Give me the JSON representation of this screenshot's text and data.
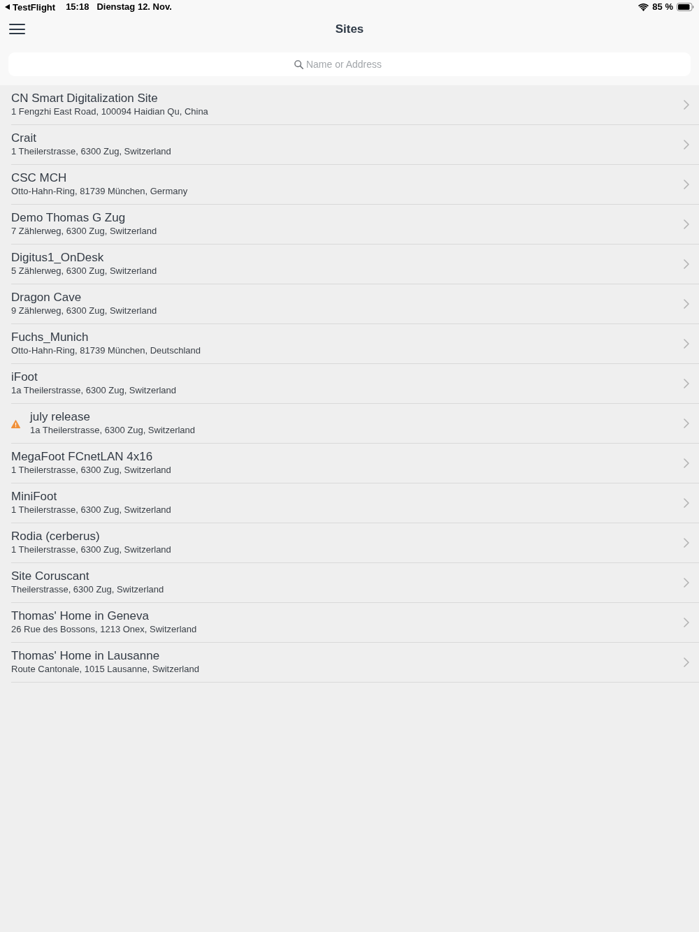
{
  "status_bar": {
    "back_app": "TestFlight",
    "time": "15:18",
    "date": "Dienstag 12. Nov.",
    "battery": "85 %"
  },
  "nav_bar": {
    "title": "Sites"
  },
  "search": {
    "placeholder": "Name or Address"
  },
  "sites": [
    {
      "name": "CN Smart Digitalization Site",
      "address": "1 Fengzhi East Road, 100094 Haidian Qu, China",
      "warning": false
    },
    {
      "name": "Crait",
      "address": "1 Theilerstrasse, 6300 Zug, Switzerland",
      "warning": false
    },
    {
      "name": "CSC MCH",
      "address": "Otto-Hahn-Ring, 81739 München, Germany",
      "warning": false
    },
    {
      "name": "Demo Thomas G Zug",
      "address": "7 Zählerweg, 6300 Zug, Switzerland",
      "warning": false
    },
    {
      "name": "Digitus1_OnDesk",
      "address": "5 Zählerweg, 6300 Zug, Switzerland",
      "warning": false
    },
    {
      "name": "Dragon Cave",
      "address": "9 Zählerweg, 6300 Zug, Switzerland",
      "warning": false
    },
    {
      "name": "Fuchs_Munich",
      "address": "Otto-Hahn-Ring, 81739 München, Deutschland",
      "warning": false
    },
    {
      "name": "iFoot",
      "address": "1a Theilerstrasse, 6300 Zug, Switzerland",
      "warning": false
    },
    {
      "name": "july release",
      "address": "1a Theilerstrasse, 6300 Zug, Switzerland",
      "warning": true
    },
    {
      "name": "MegaFoot FCnetLAN 4x16",
      "address": "1 Theilerstrasse, 6300 Zug, Switzerland",
      "warning": false
    },
    {
      "name": "MiniFoot",
      "address": "1 Theilerstrasse, 6300 Zug, Switzerland",
      "warning": false
    },
    {
      "name": "Rodia (cerberus)",
      "address": "1 Theilerstrasse, 6300 Zug, Switzerland",
      "warning": false
    },
    {
      "name": "Site Coruscant",
      "address": "Theilerstrasse, 6300 Zug, Switzerland",
      "warning": false
    },
    {
      "name": "Thomas' Home in Geneva",
      "address": "26 Rue des Bossons, 1213 Onex, Switzerland",
      "warning": false
    },
    {
      "name": "Thomas' Home in Lausanne",
      "address": "Route Cantonale, 1015 Lausanne, Switzerland",
      "warning": false
    }
  ]
}
